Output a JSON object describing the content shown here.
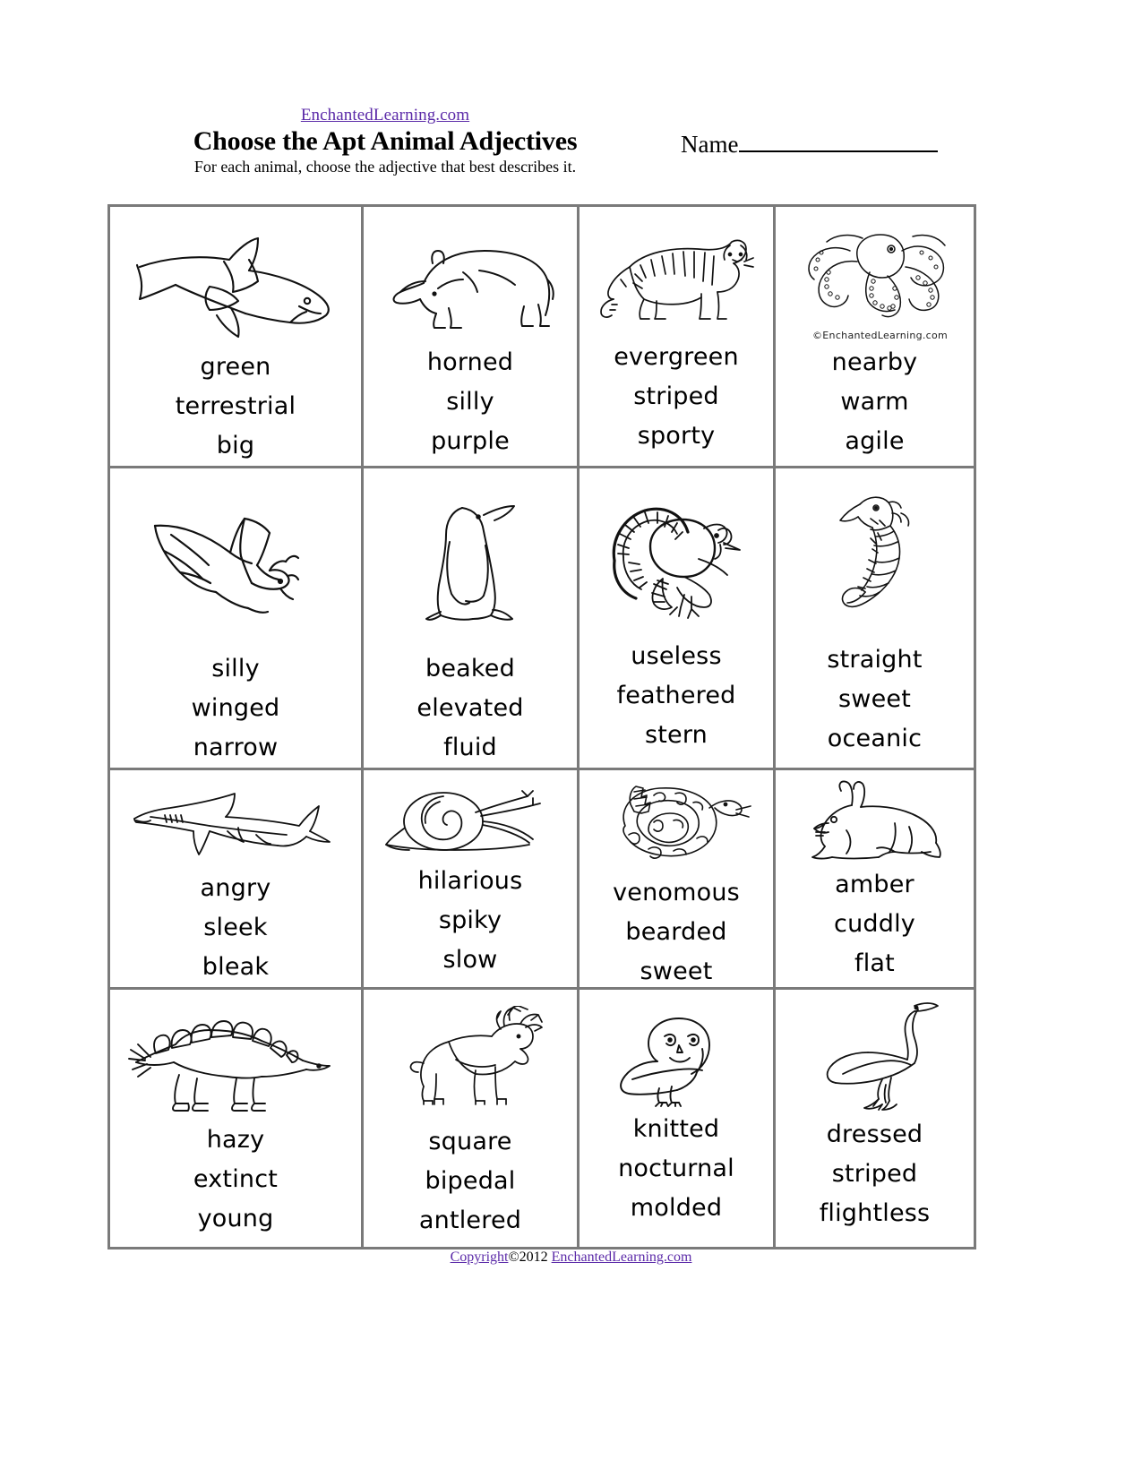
{
  "header": {
    "site_link": "EnchantedLearning.com",
    "title": "Choose the Apt Animal Adjectives",
    "instructions": "For each animal, choose the adjective that best describes it.",
    "name_label": "Name"
  },
  "footer": {
    "copyright_link": "Copyright",
    "copyright_text": "©2012 ",
    "site_link": "EnchantedLearning.com"
  },
  "watermark": "©EnchantedLearning.com",
  "grid": {
    "rows": 4,
    "columns": 4,
    "cells": [
      {
        "animal": "orca",
        "words": [
          "green",
          "terrestrial",
          "big"
        ]
      },
      {
        "animal": "rhinoceros",
        "words": [
          "horned",
          "silly",
          "purple"
        ]
      },
      {
        "animal": "tiger",
        "words": [
          "evergreen",
          "striped",
          "sporty"
        ]
      },
      {
        "animal": "octopus",
        "words": [
          "nearby",
          "warm",
          "agile"
        ]
      },
      {
        "animal": "bat",
        "words": [
          "silly",
          "winged",
          "narrow"
        ]
      },
      {
        "animal": "penguin",
        "words": [
          "beaked",
          "elevated",
          "fluid"
        ]
      },
      {
        "animal": "turkey",
        "words": [
          "useless",
          "feathered",
          "stern"
        ]
      },
      {
        "animal": "seahorse",
        "words": [
          "straight",
          "sweet",
          "oceanic"
        ]
      },
      {
        "animal": "shark",
        "words": [
          "angry",
          "sleek",
          "bleak"
        ]
      },
      {
        "animal": "snail",
        "words": [
          "hilarious",
          "spiky",
          "slow"
        ]
      },
      {
        "animal": "rattlesnake",
        "words": [
          "venomous",
          "bearded",
          "sweet"
        ]
      },
      {
        "animal": "rabbit",
        "words": [
          "amber",
          "cuddly",
          "flat"
        ]
      },
      {
        "animal": "stegosaurus",
        "words": [
          "hazy",
          "extinct",
          "young"
        ]
      },
      {
        "animal": "reindeer",
        "words": [
          "square",
          "bipedal",
          "antlered"
        ]
      },
      {
        "animal": "owl",
        "words": [
          "knitted",
          "nocturnal",
          "molded"
        ]
      },
      {
        "animal": "ostrich",
        "words": [
          "dressed",
          "striped",
          "flightless"
        ]
      }
    ]
  },
  "colors": {
    "link": "#5b2aa8",
    "grid_line": "#7a7a7a",
    "text": "#000000",
    "background": "#ffffff"
  }
}
